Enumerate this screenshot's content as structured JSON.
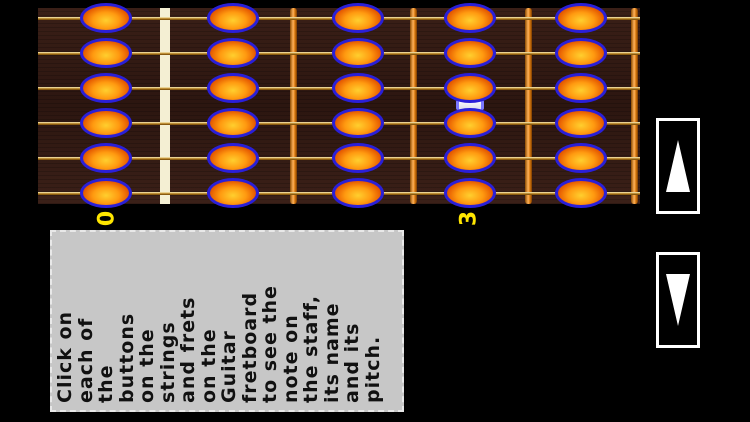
{
  "fretboard": {
    "strings": 6,
    "fret_labels": [
      {
        "fret": 0,
        "label": "0"
      },
      {
        "fret": 3,
        "label": "3"
      }
    ],
    "highlighted_position": {
      "string": 4,
      "fret": 3
    }
  },
  "info": {
    "text": "Click on\neach of\nthe\nbuttons\non the\nstrings\nand frets\non the\nGuitar\nfretboard\nto see the\nnote on\nthe staff,\nits name\nand its\npitch."
  },
  "controls": {
    "up_icon": "arrow-up-icon",
    "down_icon": "arrow-down-icon"
  },
  "colors": {
    "note_fill": "#ff9a10",
    "note_border": "#2a1fd8",
    "fret_label": "#ffe600",
    "info_bg": "#c7c7c7"
  }
}
